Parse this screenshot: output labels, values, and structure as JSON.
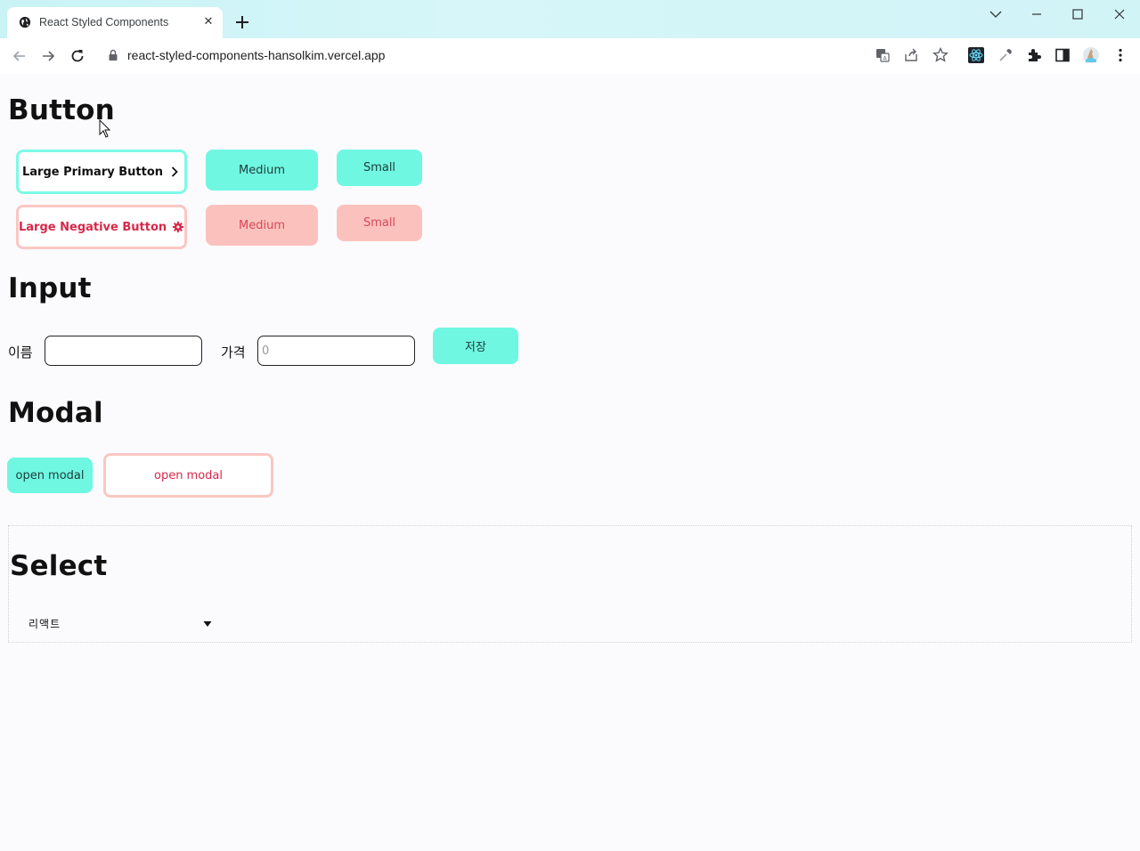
{
  "browser": {
    "tab_title": "React Styled Components",
    "tab_close": "✕",
    "url": "react-styled-components-hansolkim.vercel.app"
  },
  "sections": {
    "button": {
      "title": "Button",
      "large_primary_label": "Large Primary Button",
      "medium_primary_label": "Medium",
      "small_primary_label": "Small",
      "large_negative_label": "Large Negative Button",
      "medium_negative_label": "Medium",
      "small_negative_label": "Small"
    },
    "input": {
      "title": "Input",
      "name_label": "이름",
      "name_value": "",
      "price_label": "가격",
      "price_placeholder": "0",
      "save_label": "저장"
    },
    "modal": {
      "title": "Modal",
      "open_primary_label": "open modal",
      "open_negative_label": "open modal"
    },
    "select": {
      "title": "Select",
      "selected_value": "리액트"
    }
  },
  "colors": {
    "mint": "#6ff7e2",
    "mint_border": "#7dfae6",
    "pink": "#fbc2bd",
    "pink_border": "#fac7c2",
    "negative_text": "#d8284a"
  },
  "icons": [
    "globe-icon",
    "plus-icon",
    "back-arrow-icon",
    "forward-arrow-icon",
    "reload-icon",
    "lock-icon",
    "translate-icon",
    "share-icon",
    "star-icon",
    "react-devtools-icon",
    "eyedropper-icon",
    "extensions-icon",
    "sidepanel-icon",
    "profile-avatar",
    "kebab-menu-icon",
    "chevron-right-icon",
    "gear-icon",
    "caret-down-icon"
  ]
}
